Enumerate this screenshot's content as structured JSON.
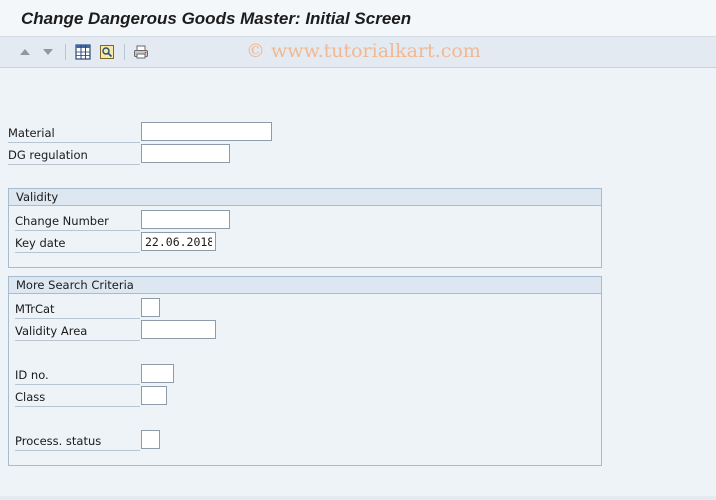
{
  "window": {
    "title": "Change Dangerous Goods Master: Initial Screen"
  },
  "toolbar": {
    "icons": [
      "arrow-up-icon",
      "arrow-down-icon",
      "table-icon",
      "overview-icon",
      "print-icon"
    ]
  },
  "watermark": "© www.tutorialkart.com",
  "fields": {
    "material": {
      "label": "Material",
      "value": ""
    },
    "dg_regulation": {
      "label": "DG regulation",
      "value": ""
    }
  },
  "validity": {
    "title": "Validity",
    "change_number": {
      "label": "Change Number",
      "value": ""
    },
    "key_date": {
      "label": "Key date",
      "value": "22.06.2018"
    }
  },
  "search": {
    "title": "More Search Criteria",
    "mtrcat": {
      "label": "MTrCat",
      "value": ""
    },
    "validity_area": {
      "label": "Validity Area",
      "value": ""
    },
    "id_no": {
      "label": "ID no.",
      "value": ""
    },
    "class": {
      "label": "Class",
      "value": ""
    },
    "process_status": {
      "label": "Process. status",
      "value": ""
    }
  },
  "colors": {
    "background": "#eef3f8",
    "group_header": "#dde7f1",
    "watermark": "#f2b893"
  }
}
